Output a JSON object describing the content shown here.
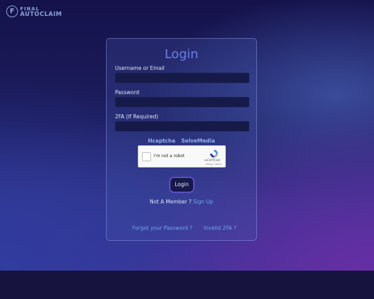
{
  "brand": {
    "icon_letter": "F",
    "line1": "FINAL",
    "line2": "AUTOCLAIM"
  },
  "login": {
    "title": "Login",
    "username_label": "Username or Email",
    "username_value": "",
    "password_label": "Password",
    "password_value": "",
    "twofa_label": "2FA (If Required)",
    "twofa_value": "",
    "captcha_options": [
      "Hcaptcha",
      "SolveMedia"
    ],
    "recaptcha": {
      "checkbox_label": "I'm not a robot",
      "brand": "reCAPTCHA",
      "links": "Privacy - Terms"
    },
    "submit_label": "Login",
    "member_text": "Not A Member ?",
    "signup_label": "Sign Up",
    "forgot_label": "Forgot your Password ?",
    "invalid_2fa_label": "Invalid 2FA ?"
  },
  "colors": {
    "accent": "#6a7fe8",
    "link": "#6fa8e8",
    "button_border": "#7b5ee6"
  }
}
